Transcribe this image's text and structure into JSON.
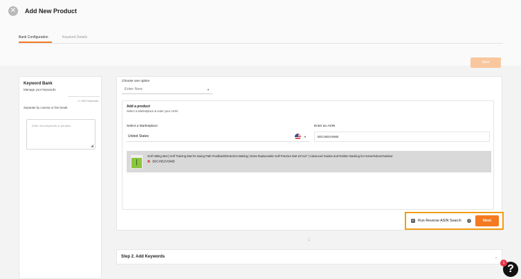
{
  "header": {
    "title": "Add New Product",
    "close_icon": "close-icon"
  },
  "tabs": [
    {
      "label": "Bank Configuration",
      "active": true
    },
    {
      "label": "Keyword Details",
      "active": false
    }
  ],
  "toolbar": {
    "save_label": "Save"
  },
  "keyword_bank": {
    "title": "Keyword Bank",
    "subtitle": "Manage your keywords",
    "count": "0 / 500 Keywords",
    "separator_hint": "Separate by comma or line break.",
    "placeholder": "Enter new keywords or phrases"
  },
  "step1": {
    "choose_label": "Choose one option",
    "choose_value": "Enter New",
    "add_title": "Add a product",
    "add_subtitle": "Select a Marketplace & enter your ASIN",
    "marketplace_label": "Select a Marketplace",
    "marketplace_value": "United States",
    "asin_label": "Enter an ASIN",
    "asin_value": "B0CHB2V5WB",
    "product_title": "Golf Hitting Mat | Golf Training Mat for Swing Path Feedback/Detection Batting | Extra Replaceable Golf Practice Mat 16\"x12\" | Advanced Guides and Rubber Backing for Home/Indoor/Outdoor",
    "product_asin": "B0CHB2V5WB",
    "reverse_label": "Run Reverse ASIN Search",
    "next_label": "Next"
  },
  "step2": {
    "title": "Step 2. Add Keywords"
  },
  "help": {
    "badge": "1",
    "icon_label": "?"
  },
  "colors": {
    "accent": "#f47920",
    "highlight_border": "#f39c12"
  }
}
